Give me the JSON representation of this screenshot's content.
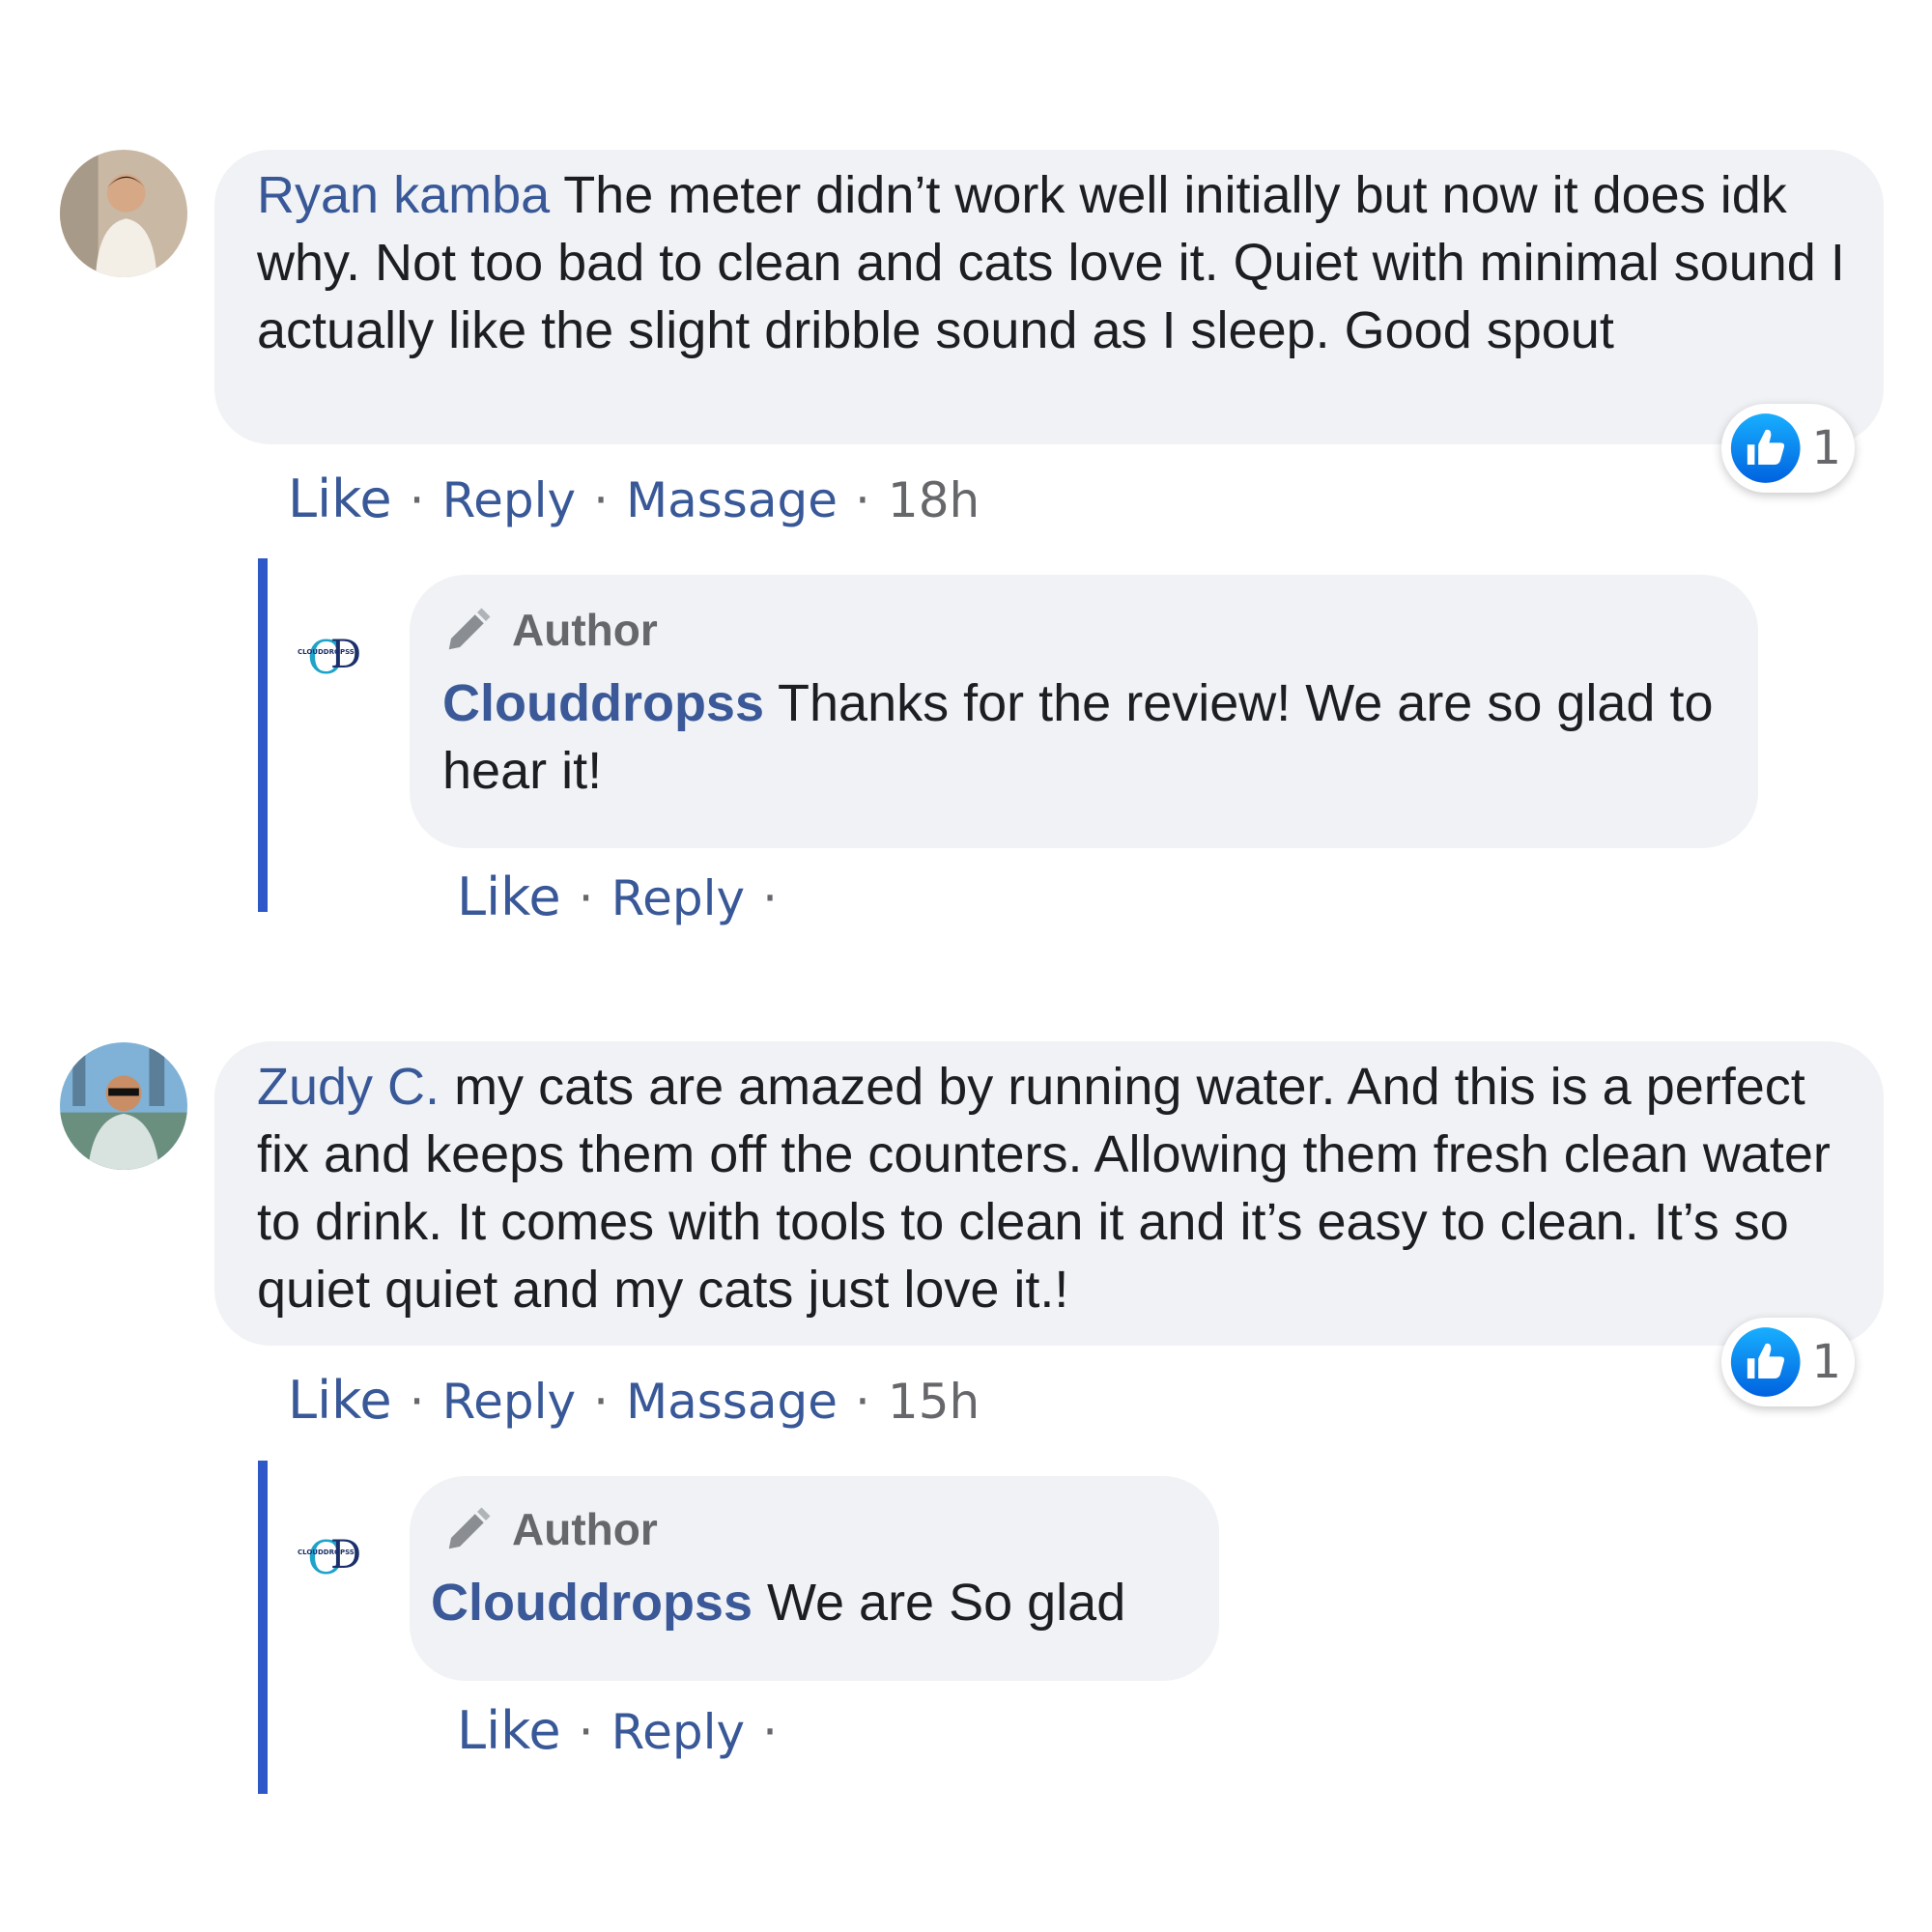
{
  "comments": [
    {
      "author": "Ryan kamba",
      "text": "The meter didn’t work well initially but now it does idk why. Not too bad to clean and cats love it. Quiet with minimal sound I actually like the slight dribble sound as I sleep. Good spout",
      "actions": {
        "like": "Like",
        "reply": "Reply",
        "message": "Massage",
        "time": "18h"
      },
      "reaction_count": "1",
      "reply": {
        "badge": "Author",
        "author": "Clouddropss",
        "text": "Thanks for the review! We are so glad to hear it!",
        "actions": {
          "like": "Like",
          "reply": "Reply"
        }
      }
    },
    {
      "author": "Zudy C.",
      "text": "my cats are amazed by running water. And this is a perfect fix and keeps them off the counters. Allowing them fresh clean water to drink. It comes with tools to clean it and it’s easy to clean. It’s so quiet quiet and my cats just love it.!",
      "actions": {
        "like": "Like",
        "reply": "Reply",
        "message": "Massage",
        "time": "15h"
      },
      "reaction_count": "1",
      "reply": {
        "badge": "Author",
        "author": "Clouddropss",
        "text": "We are So glad",
        "actions": {
          "like": "Like",
          "reply": "Reply"
        }
      }
    }
  ],
  "brand_logo_text": "CLOUDDROPSS",
  "colors": {
    "bubble": "#f0f2f5",
    "link": "#385898",
    "thread_line": "#2e57c7",
    "like_blue": "#1877f2"
  }
}
